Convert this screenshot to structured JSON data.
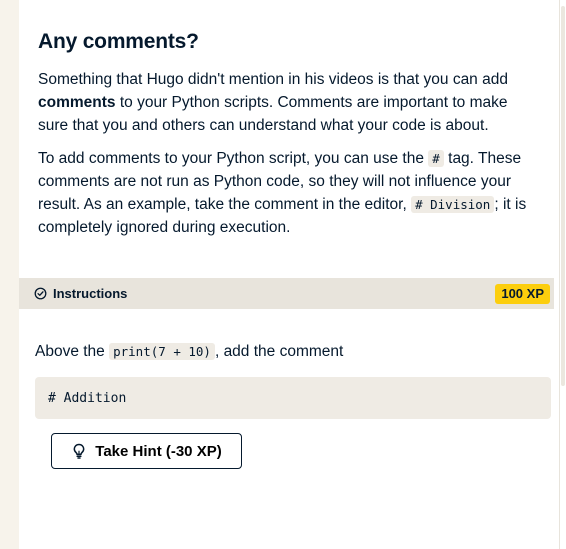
{
  "exercise": {
    "title": "Any comments?",
    "p1_before": "Something that Hugo didn't mention in his videos is that you can add ",
    "p1_bold": "comments",
    "p1_after": " to your Python scripts. Comments are important to make sure that you and others can understand what your code is about.",
    "p2_before": "To add comments to your Python script, you can use the ",
    "p2_code1": "#",
    "p2_middle": " tag. These comments are not run as Python code, so they will not influence your result. As an example, take the comment in the editor, ",
    "p2_code2": "# Division",
    "p2_after": "; it is completely ignored during execution."
  },
  "instructions": {
    "icon": "check-circle-icon",
    "label": "Instructions",
    "xp": "100 XP",
    "task_before": "Above the ",
    "task_code": "print(7 + 10)",
    "task_after": ", add the comment",
    "code": "# Addition"
  },
  "hint": {
    "icon": "lightbulb-icon",
    "label": "Take Hint (-30 XP)"
  },
  "colors": {
    "text": "#05192d",
    "xp_badge": "#fcce0d",
    "instructions_bar": "#e8e4dc",
    "code_background": "#efebe4",
    "rail": "#f7f3eb"
  }
}
